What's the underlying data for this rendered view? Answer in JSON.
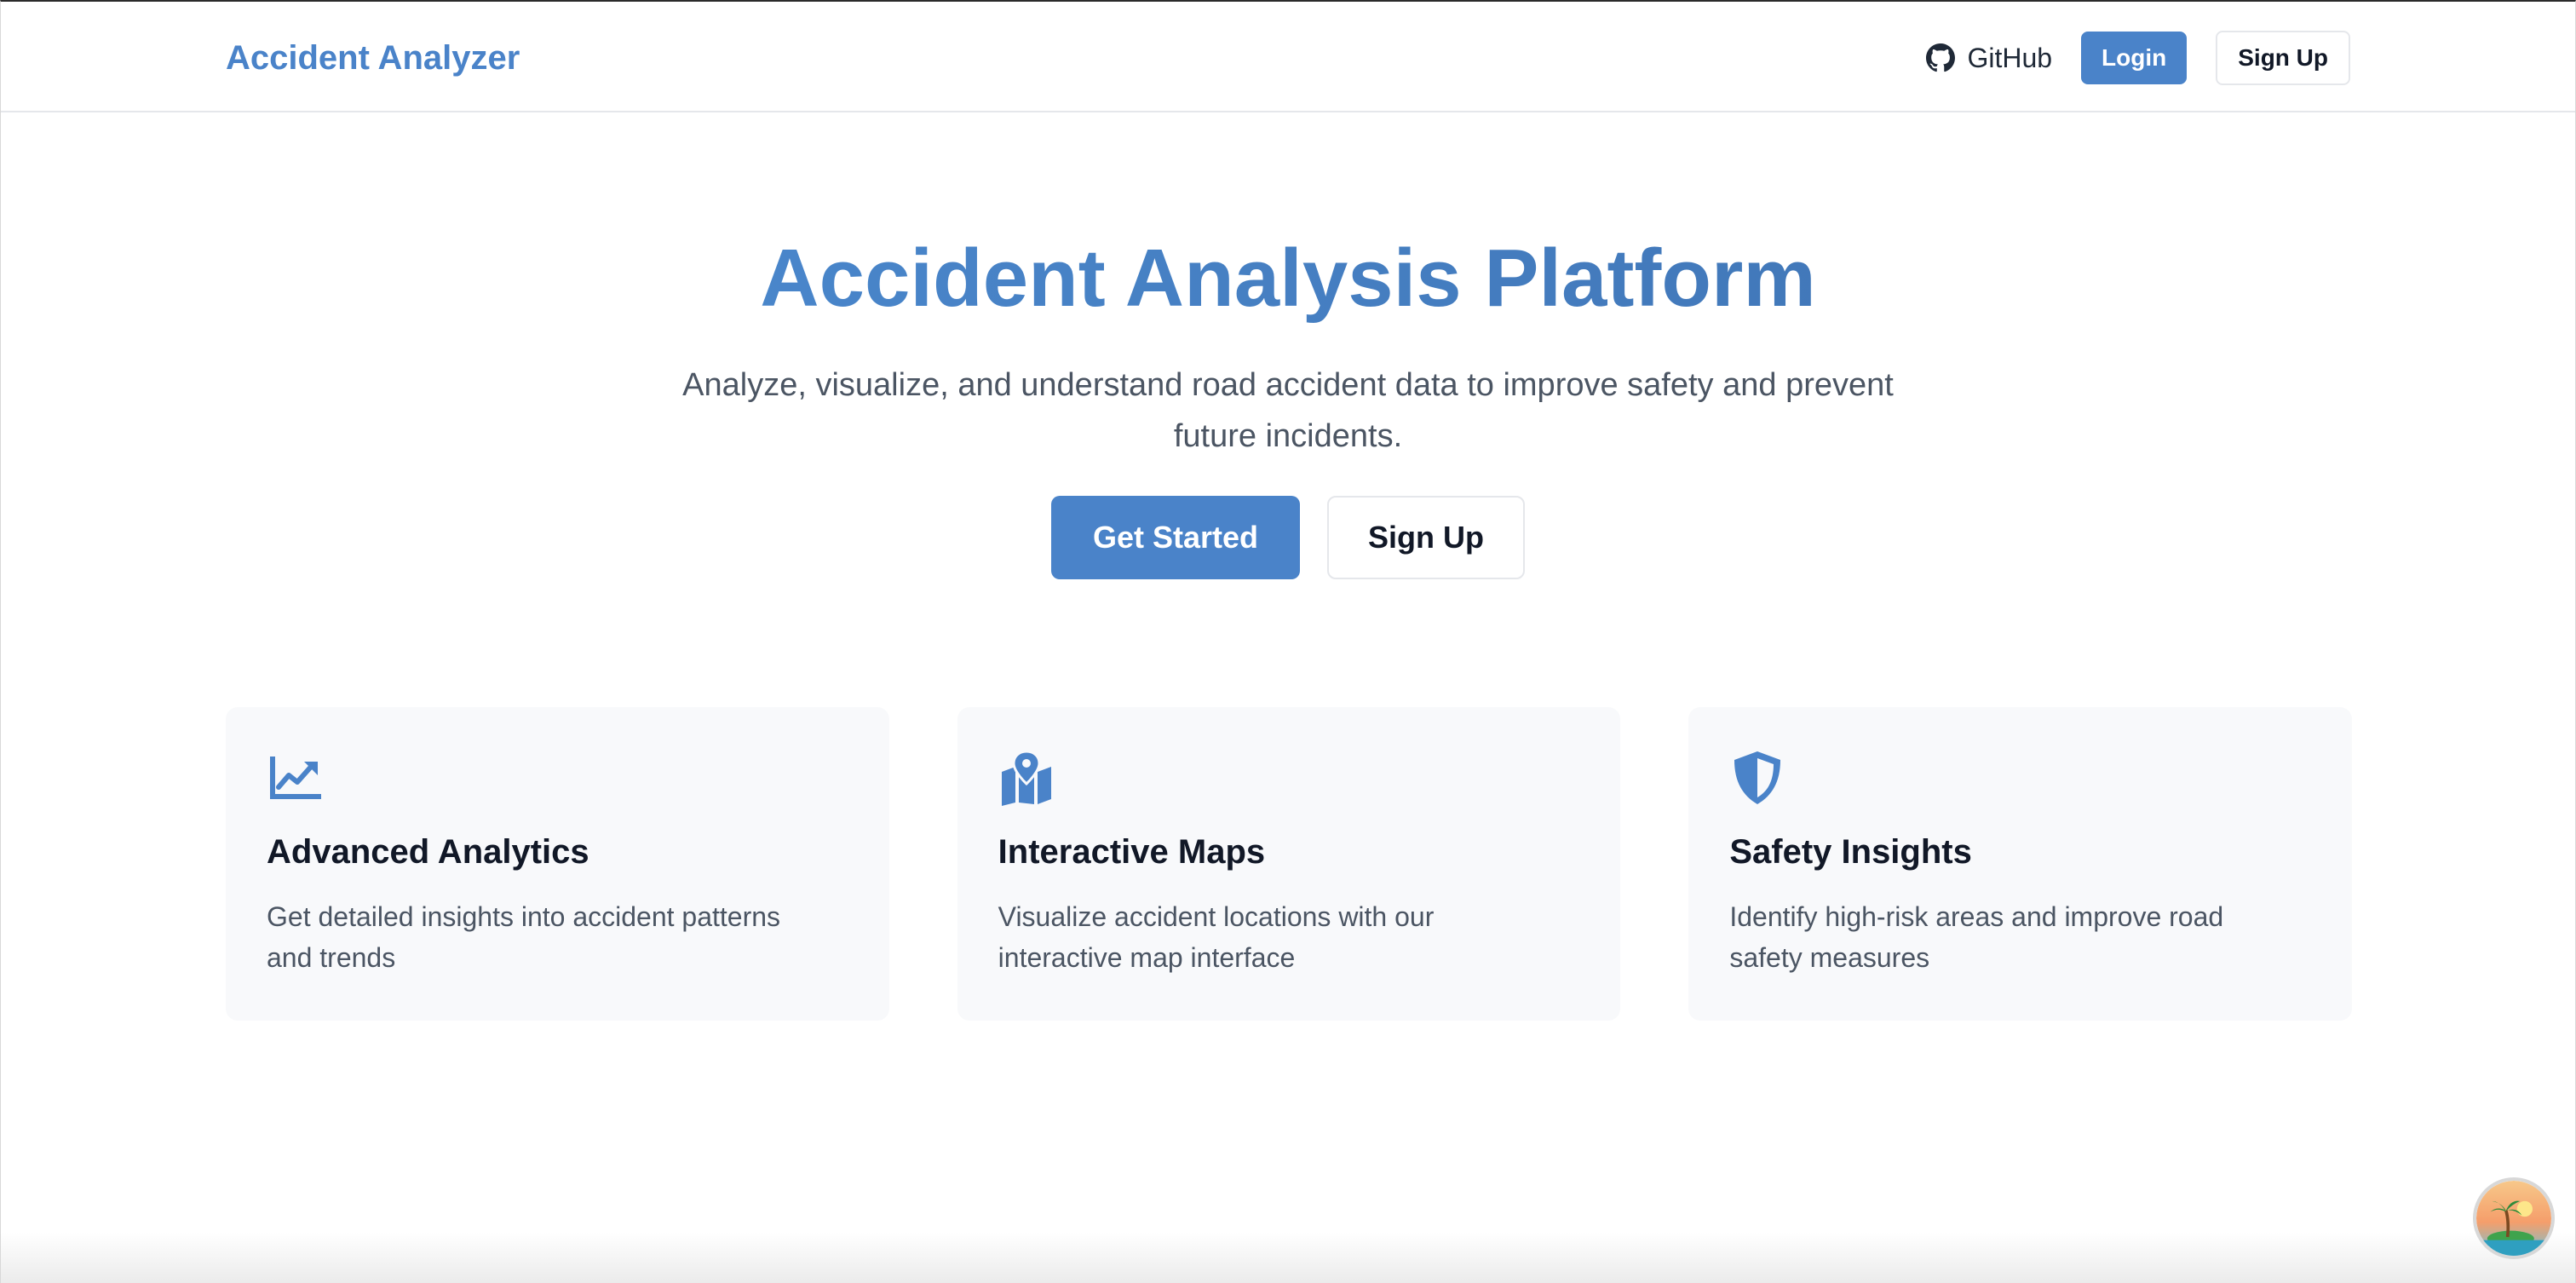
{
  "header": {
    "brand": "Accident Analyzer",
    "github_label": "GitHub",
    "login_label": "Login",
    "signup_label": "Sign Up"
  },
  "hero": {
    "title": "Accident Analysis Platform",
    "subtitle": "Analyze, visualize, and understand road accident data to improve safety and prevent future incidents.",
    "primary_label": "Get Started",
    "secondary_label": "Sign Up"
  },
  "features": [
    {
      "icon": "chart-line-icon",
      "title": "Advanced Analytics",
      "text": "Get detailed insights into accident patterns and trends"
    },
    {
      "icon": "map-location-icon",
      "title": "Interactive Maps",
      "text": "Visualize accident locations with our interactive map interface"
    },
    {
      "icon": "shield-icon",
      "title": "Safety Insights",
      "text": "Identify high-risk areas and improve road safety measures"
    }
  ],
  "floating_avatar": {
    "icon": "island-avatar-icon"
  },
  "colors": {
    "accent": "#4a83c9",
    "title_gradient_start": "#4e8fd6",
    "title_gradient_end": "#3d6fae",
    "text_dark": "#111827",
    "text_muted": "#4b5563",
    "card_bg": "#f8f9fb"
  }
}
